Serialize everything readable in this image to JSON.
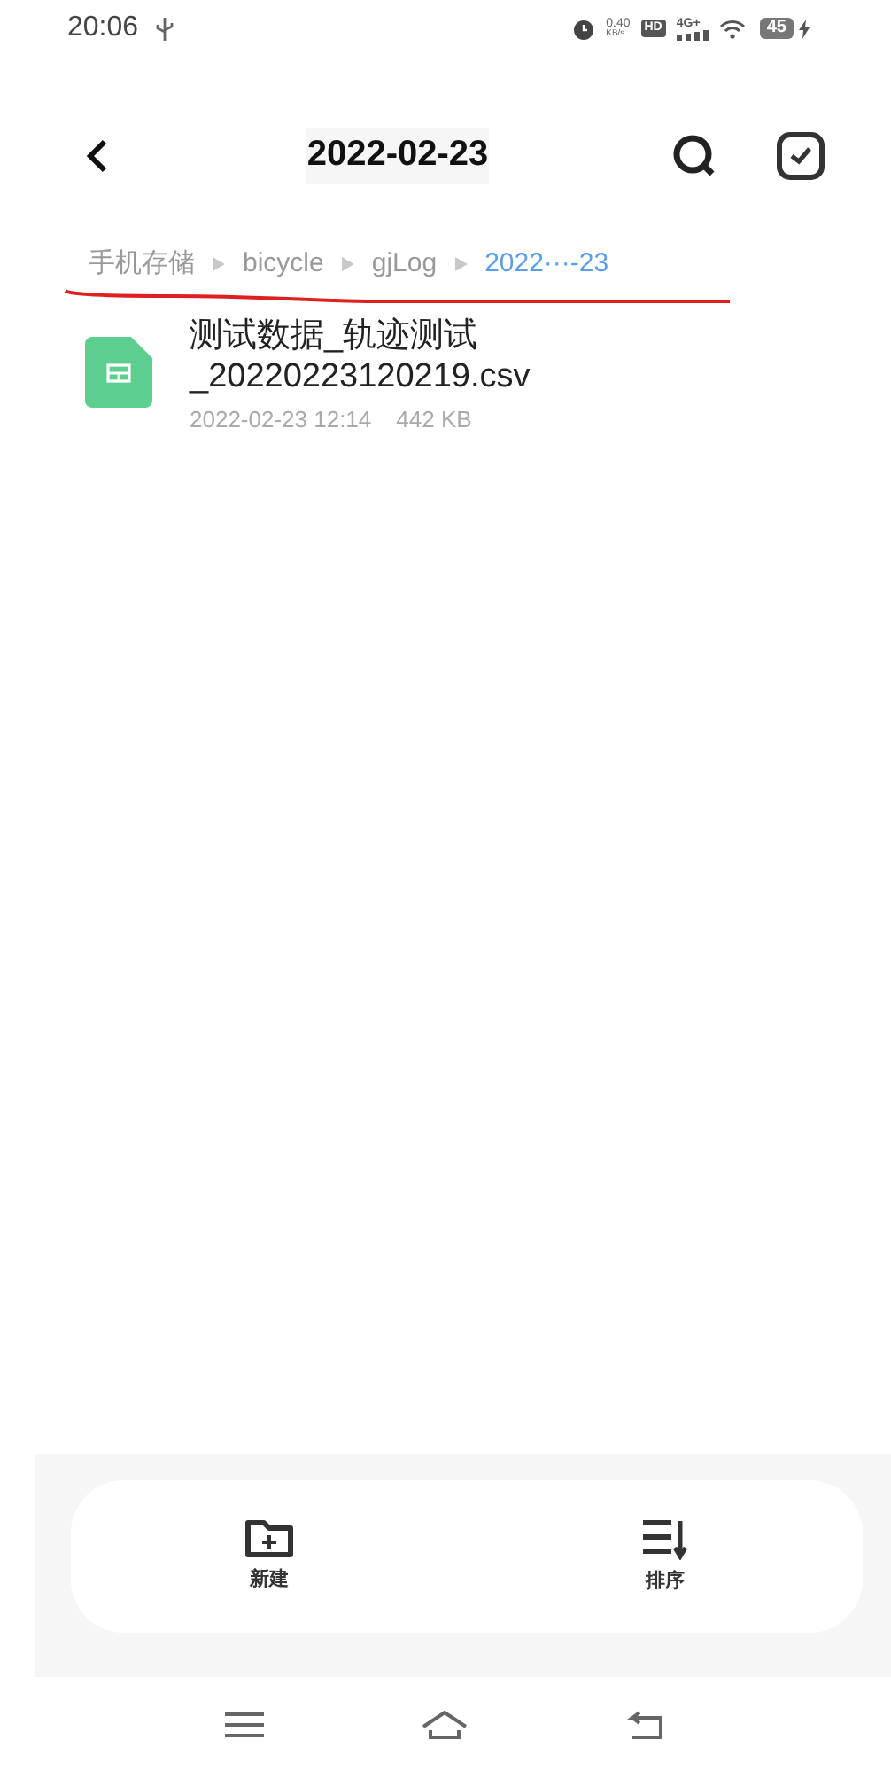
{
  "status_bar": {
    "time": "20:06",
    "net_speed": "0.40",
    "net_unit": "KB/s",
    "hd": "HD",
    "network": "4G+",
    "battery": "45"
  },
  "header": {
    "title": "2022-02-23"
  },
  "breadcrumb": [
    {
      "label": "手机存储",
      "selected": false
    },
    {
      "label": "bicycle",
      "selected": false
    },
    {
      "label": "gjLog",
      "selected": false
    },
    {
      "label": "2022···-23",
      "selected": true
    }
  ],
  "files": [
    {
      "name": "测试数据_轨迹测试_20220223120219.csv",
      "modified": "2022-02-23 12:14",
      "size": "442 KB"
    }
  ],
  "actions": [
    {
      "kind": "new",
      "label": "新建"
    },
    {
      "kind": "sort",
      "label": "排序"
    }
  ]
}
